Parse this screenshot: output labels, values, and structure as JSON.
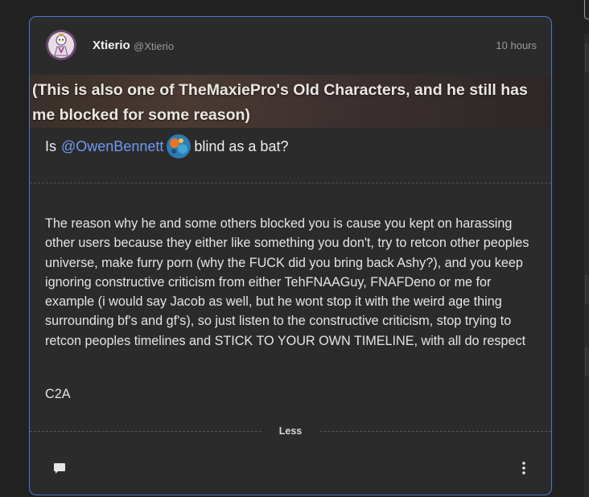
{
  "post": {
    "author_name": "Xtierio",
    "author_handle": "@Xtierio",
    "timestamp": "10 hours",
    "banner_text": "(This is also one of TheMaxiePro's Old Characters, and he still has me blocked for some reason)",
    "question_prefix": "Is",
    "question_mention": "@OwenBennett",
    "question_suffix": "blind as a bat?"
  },
  "reply": {
    "body": "The reason why he and some others blocked you is cause you kept on harassing other users because they either like something you don't, try to retcon other peoples universe, make furry porn (why the FUCK did you bring back Ashy?), and you keep ignoring constructive criticism from either TehFNAAGuy, FNAFDeno or me for example (i would say Jacob as well, but he wont stop it with the weird age thing surrounding bf's and gf's), so just listen to the constructive criticism, stop trying to retcon peoples timelines and STICK TO YOUR OWN TIMELINE, with all do respect",
    "signature": "C2A"
  },
  "actions": {
    "less_label": "Less"
  },
  "colors": {
    "accent_border": "#4a76d6",
    "mention": "#6f9af0",
    "card_background": "#2b2b2c",
    "page_background": "#212121"
  },
  "icons": {
    "avatar": "character-avatar",
    "mention_avatar": "colorful-avatar",
    "comment": "comment-icon",
    "more": "more-vertical-icon"
  }
}
